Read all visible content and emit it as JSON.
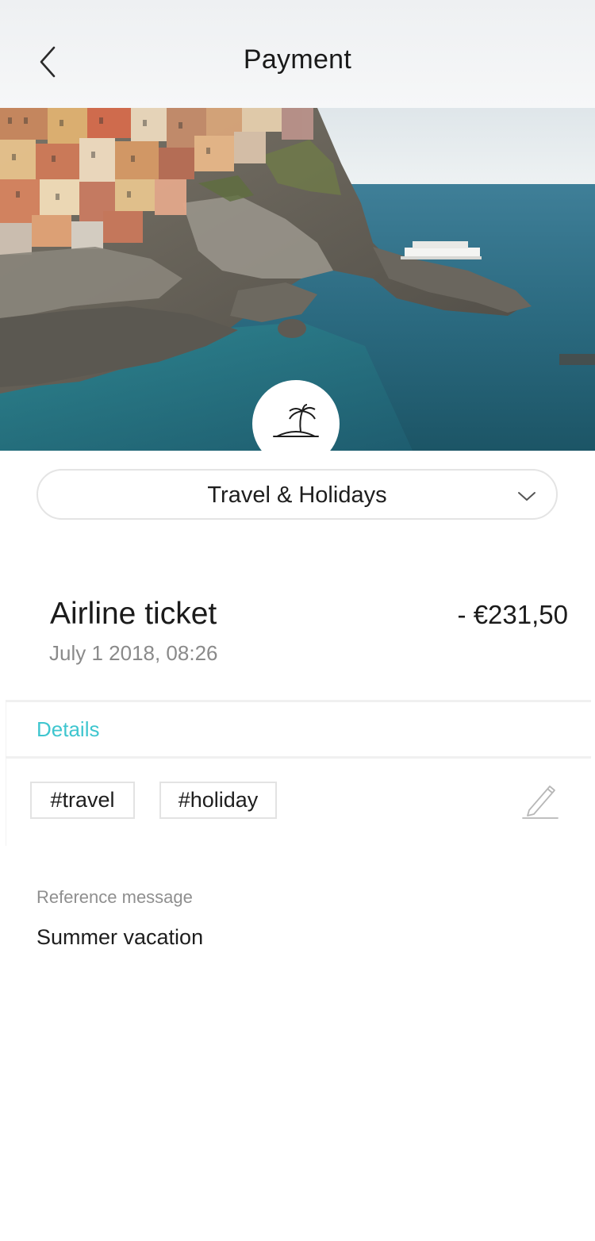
{
  "header": {
    "title": "Payment",
    "back_icon": "chevron-left-icon"
  },
  "hero": {
    "image": "coastal village on cliffs by the sea",
    "category_icon": "palm-island-icon"
  },
  "category": {
    "selected": "Travel & Holidays",
    "dropdown_icon": "chevron-down-icon"
  },
  "transaction": {
    "title": "Airline ticket",
    "amount": "- €231,50",
    "date": "July 1 2018, 08:26"
  },
  "details": {
    "tab_label": "Details",
    "tags": [
      "#travel",
      "#holiday"
    ],
    "edit_icon": "pencil-icon"
  },
  "reference": {
    "label": "Reference message",
    "value": "Summer vacation"
  },
  "colors": {
    "accent": "#3fc6cf",
    "sea": "#2f6f86",
    "text_secondary": "#8a8a8a"
  }
}
